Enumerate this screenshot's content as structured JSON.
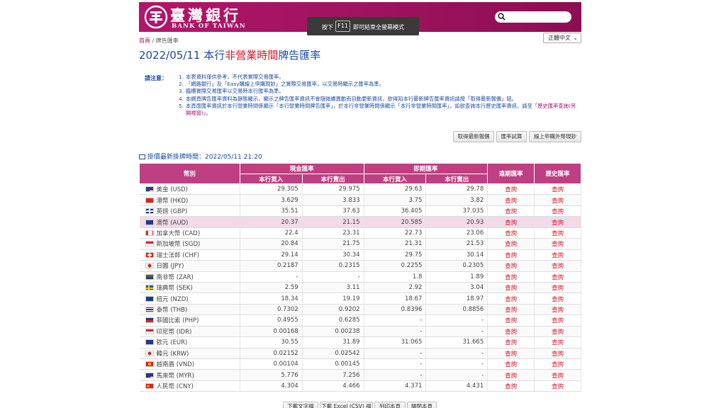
{
  "header": {
    "logo_cn": "臺灣銀行",
    "logo_en": "BANK OF TAIWAN",
    "search_placeholder": ""
  },
  "fullscreen_hint": {
    "before": "按下",
    "key": "F11",
    "after": "即可結束全螢幕模式"
  },
  "breadcrumb": {
    "home": "首頁",
    "sep": " / ",
    "current": "牌告匯率"
  },
  "language": "正體中文",
  "title": {
    "date": "2022/05/11",
    "part1": " 本行",
    "highlight": "非營業時間",
    "part2": "牌告匯率"
  },
  "notes": {
    "label": "請注意：",
    "items": [
      {
        "num": "1.",
        "text": "本表資料僅供參考，不代表實際交易匯率。"
      },
      {
        "num": "2.",
        "text": "「網路銀行」及「Easy購線上申購現鈔」之實際交易匯率，以交易時顯示之匯率為準。"
      },
      {
        "num": "3.",
        "text": "臨櫃實際交易匯率以交易時本行匯率為準。"
      },
      {
        "num": "4.",
        "text": "本網頁牌告匯率資料為靜態顯示，顯示之牌告匯率資訊不會隨後續異動而自動更新資訊，欲得知本行最新牌告匯率資訊請按「取得最新報價」鈕。"
      },
      {
        "num": "5.",
        "text": "本頁面匯率資訊於本行營業時間係顯示「本行營業時間牌告匯率」，於本行非營業時間係顯示「本行非營業時間匯率」，如欲查詢本行歷史匯率資訊，請至「",
        "link": "歷史匯率查詢(另開視窗)",
        "tail": "」。"
      }
    ]
  },
  "buttons": {
    "latest": "取得最新報價",
    "calc": "匯率試算",
    "buy": "線上申購外幣現鈔"
  },
  "updated": {
    "label": "掛價最新掛牌時間：",
    "time": "2022/05/11 21:20"
  },
  "table": {
    "h_currency": "幣別",
    "h_cash": "現金匯率",
    "h_spot": "即期匯率",
    "h_forward": "遠期匯率",
    "h_history": "歷史匯率",
    "h_buy": "本行買入",
    "h_sell": "本行賣出",
    "link_text": "查詢",
    "rows": [
      {
        "flag": "us",
        "name": "美金 (USD)",
        "cash_buy": "29.305",
        "cash_sell": "29.975",
        "spot_buy": "29.63",
        "spot_sell": "29.78"
      },
      {
        "flag": "hk",
        "name": "港幣 (HKD)",
        "cash_buy": "3.629",
        "cash_sell": "3.833",
        "spot_buy": "3.75",
        "spot_sell": "3.82"
      },
      {
        "flag": "gb",
        "name": "英鎊 (GBP)",
        "cash_buy": "35.51",
        "cash_sell": "37.63",
        "spot_buy": "36.405",
        "spot_sell": "37.035"
      },
      {
        "flag": "au",
        "name": "澳幣 (AUD)",
        "cash_buy": "20.37",
        "cash_sell": "21.15",
        "spot_buy": "20.585",
        "spot_sell": "20.93"
      },
      {
        "flag": "ca",
        "name": "加拿大幣 (CAD)",
        "cash_buy": "22.4",
        "cash_sell": "23.31",
        "spot_buy": "22.73",
        "spot_sell": "23.06"
      },
      {
        "flag": "sg",
        "name": "新加坡幣 (SGD)",
        "cash_buy": "20.84",
        "cash_sell": "21.75",
        "spot_buy": "21.31",
        "spot_sell": "21.53"
      },
      {
        "flag": "ch",
        "name": "瑞士法郎 (CHF)",
        "cash_buy": "29.14",
        "cash_sell": "30.34",
        "spot_buy": "29.75",
        "spot_sell": "30.14"
      },
      {
        "flag": "jp",
        "name": "日圓 (JPY)",
        "cash_buy": "0.2187",
        "cash_sell": "0.2315",
        "spot_buy": "0.2255",
        "spot_sell": "0.2305"
      },
      {
        "flag": "za",
        "name": "南非幣 (ZAR)",
        "cash_buy": "-",
        "cash_sell": "-",
        "spot_buy": "1.8",
        "spot_sell": "1.89"
      },
      {
        "flag": "se",
        "name": "瑞典幣 (SEK)",
        "cash_buy": "2.59",
        "cash_sell": "3.11",
        "spot_buy": "2.92",
        "spot_sell": "3.04"
      },
      {
        "flag": "nz",
        "name": "紐元 (NZD)",
        "cash_buy": "18.34",
        "cash_sell": "19.19",
        "spot_buy": "18.67",
        "spot_sell": "18.97"
      },
      {
        "flag": "th",
        "name": "泰幣 (THB)",
        "cash_buy": "0.7302",
        "cash_sell": "0.9202",
        "spot_buy": "0.8396",
        "spot_sell": "0.8856"
      },
      {
        "flag": "ph",
        "name": "菲國比索 (PHP)",
        "cash_buy": "0.4955",
        "cash_sell": "0.6285",
        "spot_buy": "-",
        "spot_sell": "-"
      },
      {
        "flag": "id",
        "name": "印尼幣 (IDR)",
        "cash_buy": "0.00168",
        "cash_sell": "0.00238",
        "spot_buy": "-",
        "spot_sell": "-"
      },
      {
        "flag": "eu",
        "name": "歐元 (EUR)",
        "cash_buy": "30.55",
        "cash_sell": "31.89",
        "spot_buy": "31.065",
        "spot_sell": "31.665"
      },
      {
        "flag": "kr",
        "name": "韓元 (KRW)",
        "cash_buy": "0.02152",
        "cash_sell": "0.02542",
        "spot_buy": "-",
        "spot_sell": "-"
      },
      {
        "flag": "vn",
        "name": "越南盾 (VND)",
        "cash_buy": "0.00104",
        "cash_sell": "0.00145",
        "spot_buy": "-",
        "spot_sell": "-"
      },
      {
        "flag": "my",
        "name": "馬來幣 (MYR)",
        "cash_buy": "5.776",
        "cash_sell": "7.256",
        "spot_buy": "-",
        "spot_sell": "-"
      },
      {
        "flag": "cn",
        "name": "人民幣 (CNY)",
        "cash_buy": "4.304",
        "cash_sell": "4.466",
        "spot_buy": "4.371",
        "spot_sell": "4.431"
      }
    ]
  },
  "bottom_buttons": {
    "download_txt": "下載文字檔",
    "download_csv": "下載 Excel (CSV) 檔",
    "print": "列印本頁",
    "close": "關閉本頁"
  },
  "colors": {
    "brand": "#a01460",
    "table_header": "#be3f82",
    "link_red": "#d3172a",
    "title_blue": "#1a4a9e"
  }
}
